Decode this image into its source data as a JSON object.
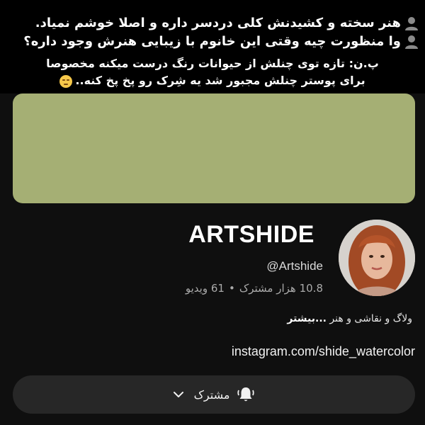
{
  "caption": {
    "line1": "هنر سخته و کشیدنش کلی دردسر داره و اصلا خوشم نمیاد.",
    "line2": "وا منظورت چیه وقتی این خانوم با زیبایی هنرش وجود داره؟",
    "line3": "پ.ن: تازه توی چنلش از حیوانات رنگ درست میکنه مخصوصا",
    "line4": "برای پوستر چنلش مجبور شد یه شِرک رو پخ پخ کنه..",
    "icon1": "person-icon",
    "icon2": "person-icon",
    "emoji": "pensive-face-emoji"
  },
  "channel": {
    "banner_color": "#a5af74",
    "name": "ARTSHIDE",
    "handle": "@Artshide",
    "subscribers": "10.8 هزار مشترک",
    "separator": "•",
    "videos": "61 ویدیو",
    "description": "ولاگ و نقاشی و هنر",
    "more_label": "...بیشتر",
    "link": "instagram.com/shide_watercolor",
    "subscribe_label": "مشترک",
    "bell_icon": "bell-ringing-icon",
    "chevron_icon": "chevron-down-icon"
  }
}
